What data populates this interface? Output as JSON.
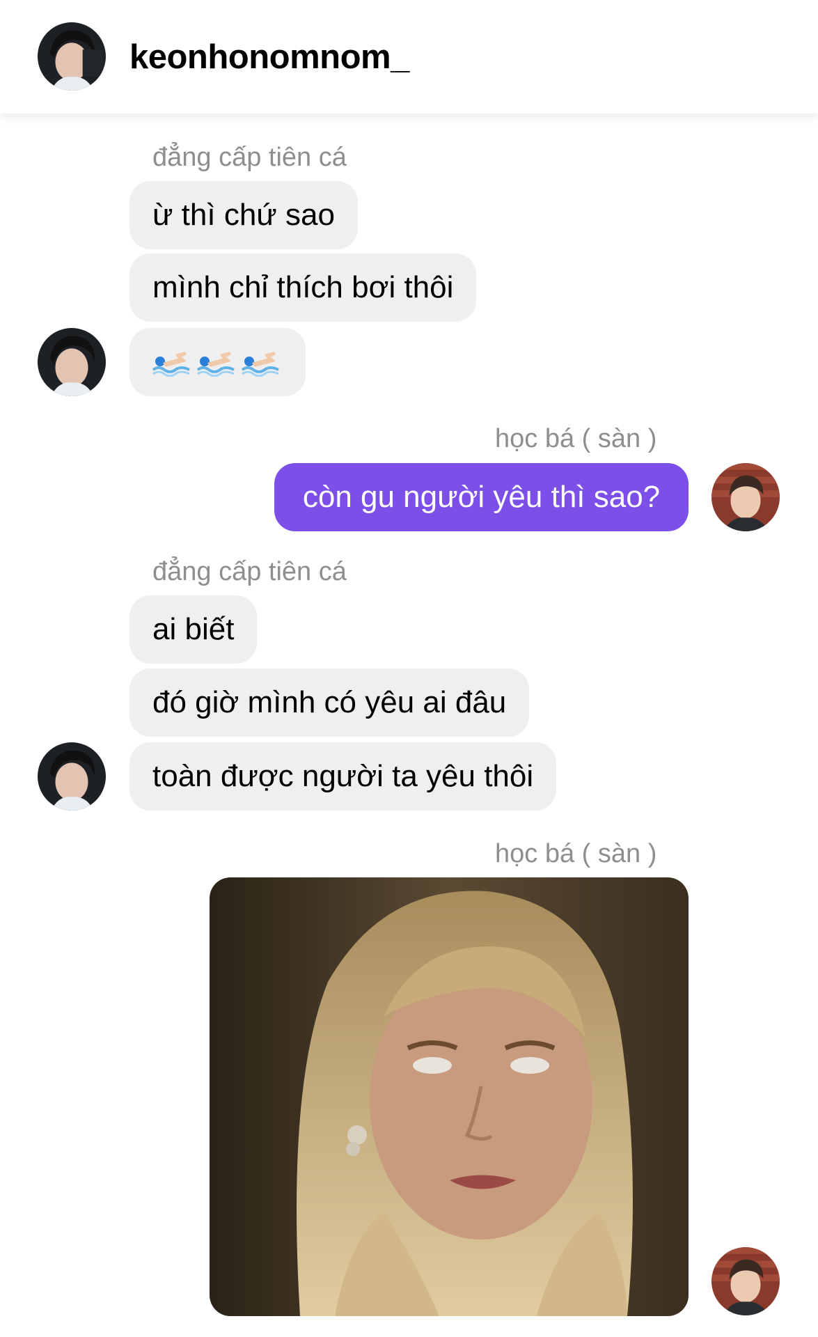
{
  "header": {
    "username": "keonhonomnom_",
    "avatar_icon": "profile-avatar-icon"
  },
  "messages": [
    {
      "sender": "đẳng cấp tiên cá",
      "text": "ừ thì chứ sao"
    },
    {
      "text": "mình chỉ thích bơi thôi"
    },
    {
      "emoji": "swimmer-emoji",
      "count": 3
    },
    {
      "sender": "học bá ( sàn )",
      "text": "còn gu người yêu thì sao?"
    },
    {
      "sender": "đẳng cấp tiên cá",
      "text": "ai biết"
    },
    {
      "text": "đó giờ mình có yêu ai đâu"
    },
    {
      "text": "toàn được người ta yêu thôi"
    },
    {
      "sender": "học bá ( sàn )",
      "attachment": "photo"
    }
  ],
  "colors": {
    "outgoing_bubble": "#7b4fe8",
    "incoming_bubble": "#efeff0",
    "sender_label": "#8e8e8e"
  }
}
